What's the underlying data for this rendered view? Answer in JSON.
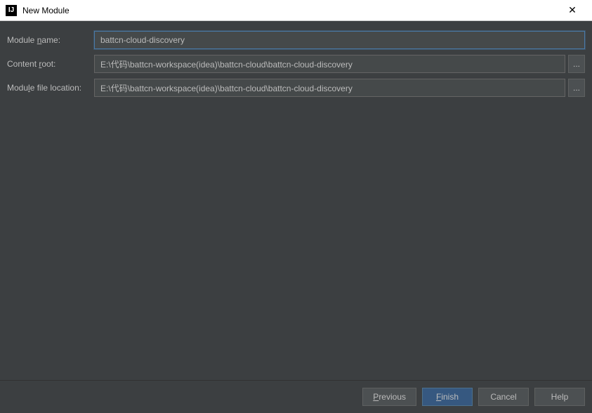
{
  "titlebar": {
    "icon_text": "IJ",
    "title": "New Module",
    "close_symbol": "✕"
  },
  "form": {
    "module_name": {
      "label_pre": "Module ",
      "label_u": "n",
      "label_post": "ame:",
      "value": "battcn-cloud-discovery"
    },
    "content_root": {
      "label_pre": "Content ",
      "label_u": "r",
      "label_post": "oot:",
      "value": "E:\\代码\\battcn-workspace(idea)\\battcn-cloud\\battcn-cloud-discovery",
      "browse": "..."
    },
    "module_file_location": {
      "label_pre": "Modu",
      "label_u": "l",
      "label_post": "e file location:",
      "value": "E:\\代码\\battcn-workspace(idea)\\battcn-cloud\\battcn-cloud-discovery",
      "browse": "..."
    }
  },
  "buttons": {
    "previous_u": "P",
    "previous_post": "revious",
    "finish_u": "F",
    "finish_post": "inish",
    "cancel": "Cancel",
    "help": "Help"
  }
}
